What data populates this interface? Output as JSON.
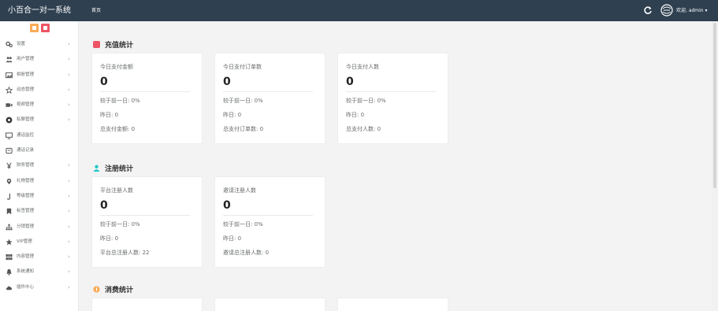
{
  "topbar": {
    "brand": "小百合一对一系统",
    "home_tab": "首页",
    "user_label": "欢迎, admin ▾"
  },
  "sidebar": {
    "items": [
      {
        "label": "设置",
        "icon": "gears-icon"
      },
      {
        "label": "用户管理",
        "icon": "users-icon"
      },
      {
        "label": "相册管理",
        "icon": "image-icon"
      },
      {
        "label": "动态管理",
        "icon": "star-icon"
      },
      {
        "label": "视频管理",
        "icon": "video-icon"
      },
      {
        "label": "私聊管理",
        "icon": "chat-icon"
      },
      {
        "label": "通话监控",
        "icon": "monitor-icon"
      },
      {
        "label": "通话记录",
        "icon": "record-icon"
      },
      {
        "label": "财务管理",
        "icon": "yen-icon"
      },
      {
        "label": "礼物管理",
        "icon": "gift-icon"
      },
      {
        "label": "等级管理",
        "icon": "level-icon"
      },
      {
        "label": "标签管理",
        "icon": "bookmark-icon"
      },
      {
        "label": "分销管理",
        "icon": "sitemap-icon"
      },
      {
        "label": "VIP管理",
        "icon": "vip-star-icon"
      },
      {
        "label": "内容管理",
        "icon": "grid-icon"
      },
      {
        "label": "系统通知",
        "icon": "bell-icon"
      },
      {
        "label": "插件中心",
        "icon": "cloud-icon"
      }
    ]
  },
  "sections": {
    "pay": {
      "title": "充值统计",
      "color": "#ed5565",
      "cards": [
        {
          "title": "今日支付金额",
          "value": "0",
          "compare": "较于前一日: 0%",
          "yesterday": "昨日: 0",
          "total": "总支付金额: 0"
        },
        {
          "title": "今日支付订单数",
          "value": "0",
          "compare": "较于前一日: 0%",
          "yesterday": "昨日: 0",
          "total": "总支付订单数: 0"
        },
        {
          "title": "今日支付人数",
          "value": "0",
          "compare": "较于前一日: 0%",
          "yesterday": "昨日: 0",
          "total": "总支付人数: 0"
        }
      ]
    },
    "register": {
      "title": "注册统计",
      "color": "#23c6c8",
      "cards": [
        {
          "title": "平台注册人数",
          "value": "0",
          "compare": "较于前一日: 0%",
          "yesterday": "昨日: 0",
          "total": "平台总注册人数: 22"
        },
        {
          "title": "邀请注册人数",
          "value": "0",
          "compare": "较于前一日: 0%",
          "yesterday": "昨日: 0",
          "total": "邀请总注册人数: 0"
        }
      ]
    },
    "consume": {
      "title": "消费统计",
      "color": "#f8ac59"
    }
  }
}
